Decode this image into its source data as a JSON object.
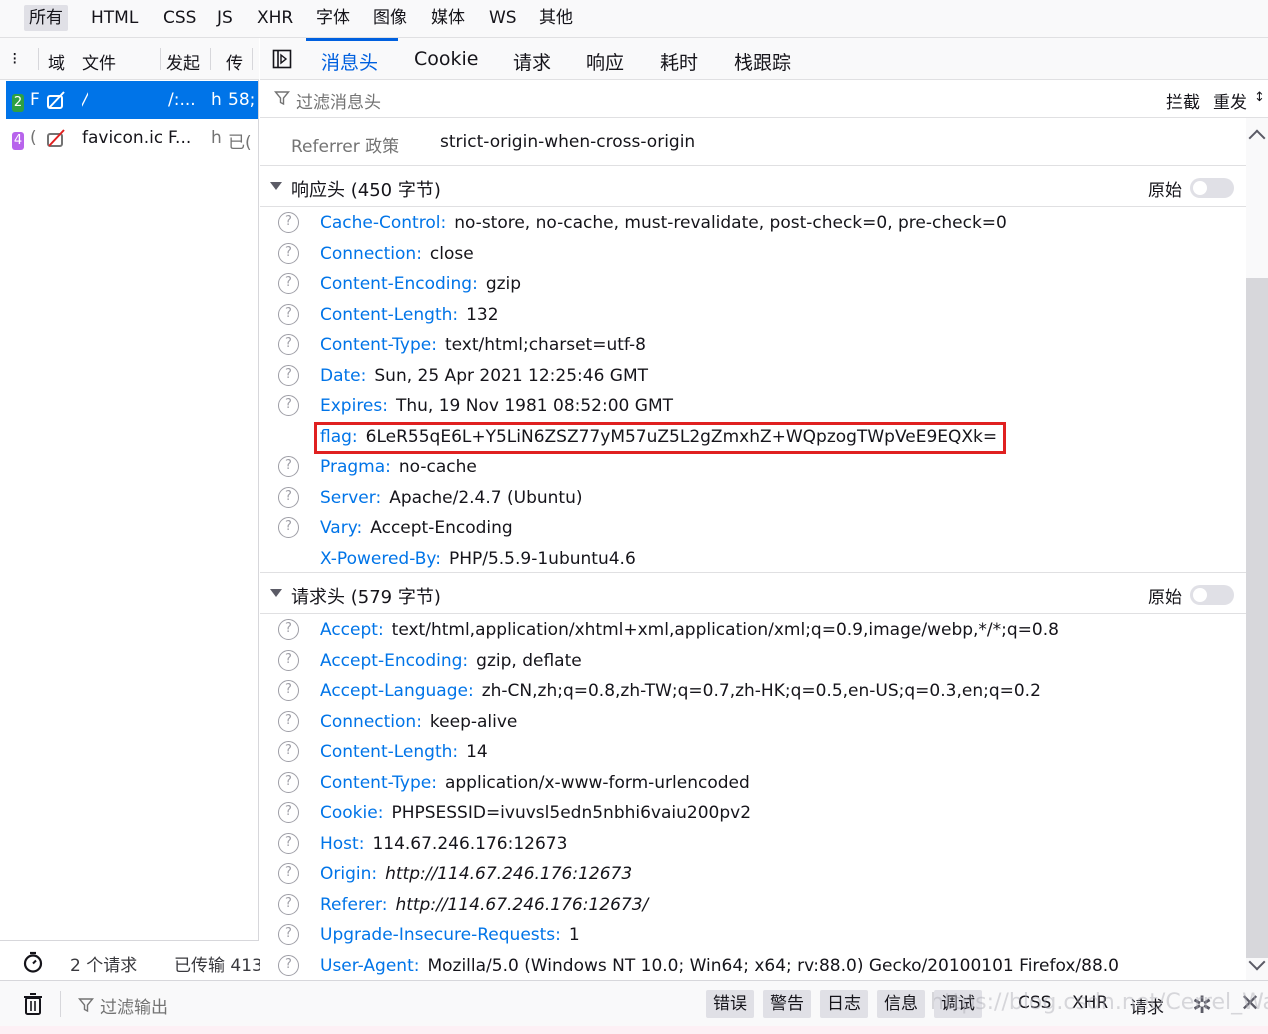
{
  "type_filters": [
    "所有",
    "HTML",
    "CSS",
    "JS",
    "XHR",
    "字体",
    "图像",
    "媒体",
    "WS",
    "其他"
  ],
  "columns": {
    "dots": "⁝",
    "domain": "域",
    "file": "文件",
    "initiator": "发起",
    "transferred": "传"
  },
  "requests": [
    {
      "status": "2",
      "method": "F",
      "file": "/",
      "initiator": "/:...",
      "type": "h",
      "size": "58;"
    },
    {
      "status": "4",
      "method": "(",
      "file": "favicon.ic",
      "initiator": "F...",
      "type": "h",
      "size": "已("
    }
  ],
  "request_footer": {
    "count": "2 个请求",
    "transferred": "已传输 413"
  },
  "tabs": [
    "消息头",
    "Cookie",
    "请求",
    "响应",
    "耗时",
    "栈跟踪"
  ],
  "filter": {
    "placeholder": "过滤消息头",
    "block": "拦截",
    "resend": "重发"
  },
  "referrer": {
    "label": "Referrer 政策",
    "value": "strict-origin-when-cross-origin"
  },
  "response_section": {
    "title": "响应头 (450 字节)",
    "raw_label": "原始"
  },
  "response_headers": [
    {
      "name": "Cache-Control:",
      "value": "no-store, no-cache, must-revalidate, post-check=0, pre-check=0",
      "help": true
    },
    {
      "name": "Connection:",
      "value": "close",
      "help": true
    },
    {
      "name": "Content-Encoding:",
      "value": "gzip",
      "help": true
    },
    {
      "name": "Content-Length:",
      "value": "132",
      "help": true
    },
    {
      "name": "Content-Type:",
      "value": "text/html;charset=utf-8",
      "help": true
    },
    {
      "name": "Date:",
      "value": "Sun, 25 Apr 2021 12:25:46 GMT",
      "help": true
    },
    {
      "name": "Expires:",
      "value": "Thu, 19 Nov 1981 08:52:00 GMT",
      "help": true
    },
    {
      "name": "flag:",
      "value": "6LeR55qE6L+Y5LiN6ZSZ77yM57uZ5L2gZmxhZ+WQpzogTWpVeE9EQXk=",
      "help": false
    },
    {
      "name": "Pragma:",
      "value": "no-cache",
      "help": true
    },
    {
      "name": "Server:",
      "value": "Apache/2.4.7 (Ubuntu)",
      "help": true
    },
    {
      "name": "Vary:",
      "value": "Accept-Encoding",
      "help": true
    },
    {
      "name": "X-Powered-By:",
      "value": "PHP/5.5.9-1ubuntu4.6",
      "help": false
    }
  ],
  "request_section": {
    "title": "请求头 (579 字节)",
    "raw_label": "原始"
  },
  "request_headers": [
    {
      "name": "Accept:",
      "value": "text/html,application/xhtml+xml,application/xml;q=0.9,image/webp,*/*;q=0.8"
    },
    {
      "name": "Accept-Encoding:",
      "value": "gzip, deflate"
    },
    {
      "name": "Accept-Language:",
      "value": "zh-CN,zh;q=0.8,zh-TW;q=0.7,zh-HK;q=0.5,en-US;q=0.3,en;q=0.2"
    },
    {
      "name": "Connection:",
      "value": "keep-alive"
    },
    {
      "name": "Content-Length:",
      "value": "14"
    },
    {
      "name": "Content-Type:",
      "value": "application/x-www-form-urlencoded"
    },
    {
      "name": "Cookie:",
      "value": "PHPSESSID=ivuvsl5edn5nbhi6vaiu200pv2"
    },
    {
      "name": "Host:",
      "value": "114.67.246.176:12673"
    },
    {
      "name": "Origin:",
      "value": "http://114.67.246.176:12673",
      "italic": true
    },
    {
      "name": "Referer:",
      "value": "http://114.67.246.176:12673/",
      "italic": true
    },
    {
      "name": "Upgrade-Insecure-Requests:",
      "value": "1"
    },
    {
      "name": "User-Agent:",
      "value": "Mozilla/5.0 (Windows NT 10.0; Win64; x64; rv:88.0) Gecko/20100101 Firefox/88.0"
    }
  ],
  "console": {
    "filter_placeholder": "过滤输出",
    "levels": [
      "错误",
      "警告",
      "日志",
      "信息",
      "调试"
    ],
    "categories": [
      "CSS",
      "XHR",
      "请求"
    ]
  },
  "watermark": "https://blog.csdn.net/Cerrel_Wapa",
  "colors": {
    "accent": "#0060df",
    "selected_row": "#0074e8",
    "header_name": "#0074e8",
    "highlight_box": "#e02020"
  }
}
